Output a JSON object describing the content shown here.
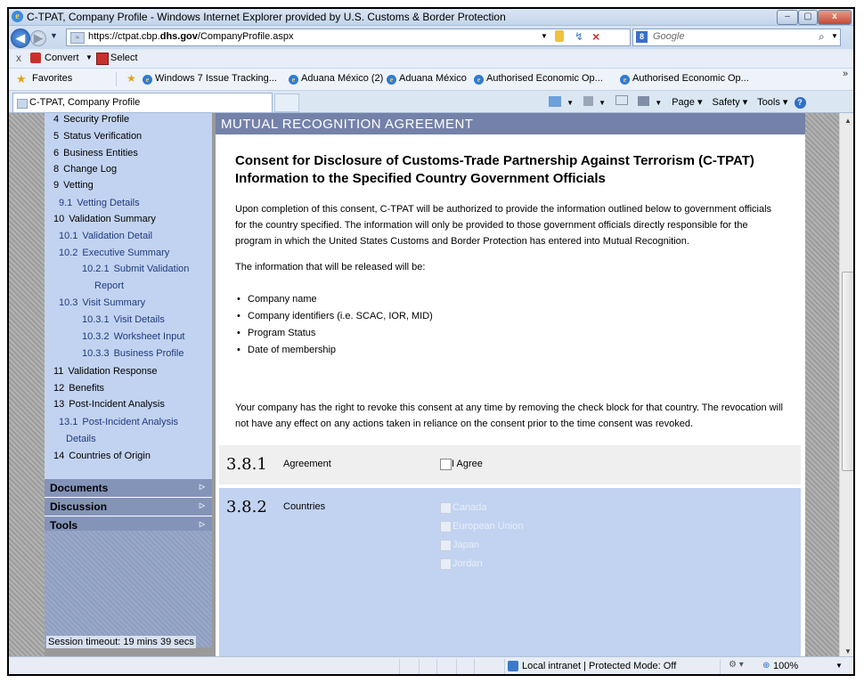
{
  "window": {
    "title": "C-TPAT, Company Profile - Windows Internet Explorer provided by U.S. Customs & Border Protection",
    "min": "–",
    "max": "▢",
    "close": "x"
  },
  "address": {
    "url_prefix": "https://ctpat.cbp.",
    "url_domain": "dhs.gov",
    "url_path": "/CompanyProfile.aspx",
    "search_placeholder": "Google"
  },
  "commandbar": {
    "close": "x",
    "convert": "Convert",
    "select": "Select"
  },
  "favorites": {
    "label": "Favorites",
    "items": [
      "Windows 7 Issue Tracking...",
      "Aduana México (2)",
      "Aduana México",
      "Authorised Economic Op...",
      "Authorised Economic Op..."
    ],
    "overflow": "»"
  },
  "tab": {
    "title": "C-TPAT, Company Profile"
  },
  "toolbar": {
    "page": "Page ▾",
    "safety": "Safety ▾",
    "tools": "Tools ▾",
    "help": "?"
  },
  "sidebar": {
    "nav": [
      {
        "num": "4",
        "label": "Security Profile"
      },
      {
        "num": "5",
        "label": "Status Verification"
      },
      {
        "num": "6",
        "label": "Business Entities"
      },
      {
        "num": "8",
        "label": "Change Log"
      },
      {
        "num": "9",
        "label": "Vetting"
      },
      {
        "num": "9.1",
        "label": "Vetting Details"
      },
      {
        "num": "10",
        "label": "Validation Summary"
      },
      {
        "num": "10.1",
        "label": "Validation Detail"
      },
      {
        "num": "10.2",
        "label": "Executive Summary"
      },
      {
        "num": "10.2.1",
        "label": "Submit Validation"
      },
      {
        "num": "",
        "label": "Report"
      },
      {
        "num": "10.3",
        "label": "Visit Summary"
      },
      {
        "num": "10.3.1",
        "label": "Visit Details"
      },
      {
        "num": "10.3.2",
        "label": "Worksheet Input"
      },
      {
        "num": "10.3.3",
        "label": "Business Profile"
      },
      {
        "num": "11",
        "label": "Validation Response"
      },
      {
        "num": "12",
        "label": "Benefits"
      },
      {
        "num": "13",
        "label": "Post-Incident Analysis"
      },
      {
        "num": "13.1",
        "label": "Post-Incident Analysis"
      },
      {
        "num": "",
        "label": "Details"
      },
      {
        "num": "14",
        "label": "Countries of Origin"
      }
    ],
    "sections": [
      "Documents",
      "Discussion",
      "Tools"
    ],
    "session_timeout": "Session timeout: 19 mins 39 secs"
  },
  "main": {
    "section_title": "MUTUAL RECOGNITION AGREEMENT",
    "heading": "Consent for Disclosure of Customs-Trade Partnership Against Terrorism (C-TPAT) Information to the Specified Country Government Officials",
    "intro_lines": [
      "Upon completion of this consent, C-TPAT will be authorized to provide the information outlined below to government officials",
      "for the country specified. The information will only be provided to those government officials directly responsible for the",
      "program in which the United States Customs and Border Protection has entered into Mutual Recognition."
    ],
    "released_label": "The information that will be released will be:",
    "bullets": [
      "Company name",
      "Company identifiers (i.e. SCAC, IOR, MID)",
      "Program Status",
      "Date of membership"
    ],
    "revoke_lines": [
      "Your company has the right to revoke this consent at any time by removing the check block for that country. The revocation will",
      "not have any effect on any actions taken in reliance on the consent prior to the time consent was revoked."
    ],
    "agreement": {
      "num": "3.8.1",
      "label": "Agreement",
      "checkbox_label": "I Agree"
    },
    "countries": {
      "num": "3.8.2",
      "label": "Countries",
      "options": [
        "Canada",
        "European Union",
        "Japan",
        "Jordan"
      ]
    }
  },
  "status": {
    "zone": "Local intranet | Protected Mode: Off",
    "zoom": "100%"
  }
}
